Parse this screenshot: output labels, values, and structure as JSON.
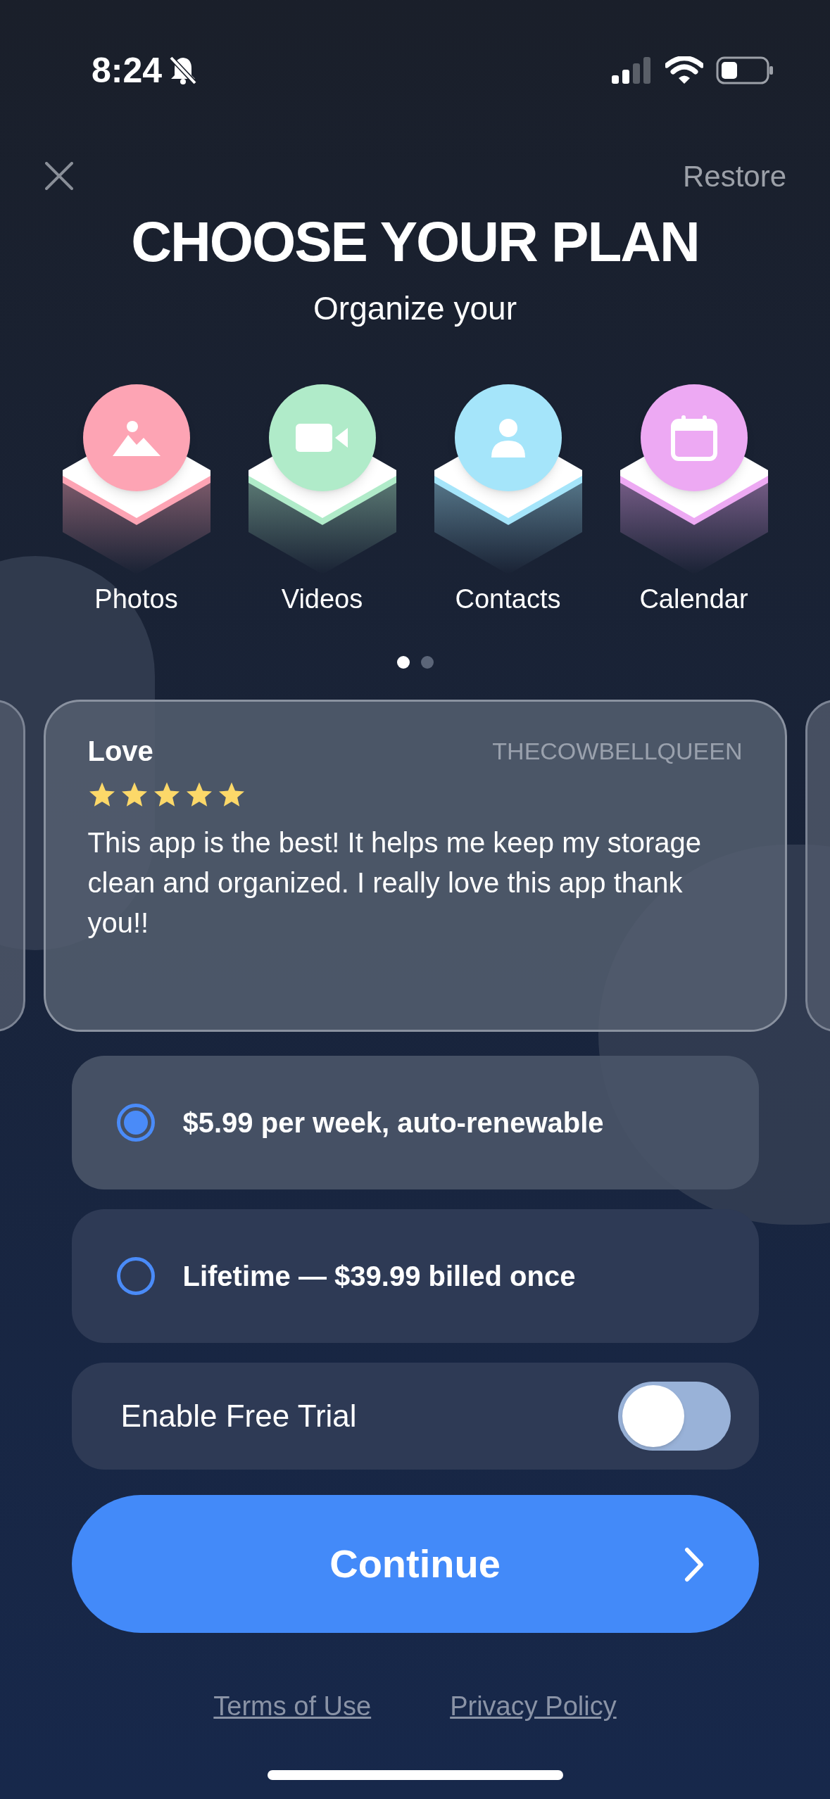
{
  "status_bar": {
    "time": "8:24",
    "silent": true
  },
  "header": {
    "restore": "Restore",
    "title": "CHOOSE YOUR PLAN",
    "subtitle": "Organize your"
  },
  "categories": [
    {
      "kind": "photos",
      "label": "Photos",
      "color": "#fda4b4"
    },
    {
      "kind": "videos",
      "label": "Videos",
      "color": "#b0ebc9"
    },
    {
      "kind": "contacts",
      "label": "Contacts",
      "color": "#a5e5fa"
    },
    {
      "kind": "calendar",
      "label": "Calendar",
      "color": "#eda9f3"
    }
  ],
  "pager": [
    {
      "selected": true
    },
    {
      "selected": false
    }
  ],
  "review": {
    "title": "Love",
    "author": "THECOWBELLQUEEN",
    "stars": 5,
    "text": "This app is the best! It helps me keep my storage clean and organized. I really love this app thank you!!"
  },
  "plans": [
    {
      "label": "$5.99 per week, auto-renewable",
      "selected": true
    },
    {
      "label": "Lifetime — $39.99 billed once",
      "selected": false
    }
  ],
  "free_trial": {
    "label": "Enable Free Trial",
    "on": false
  },
  "continue_button": {
    "label": "Continue"
  },
  "links": [
    "Terms of Use",
    "Privacy Policy"
  ]
}
